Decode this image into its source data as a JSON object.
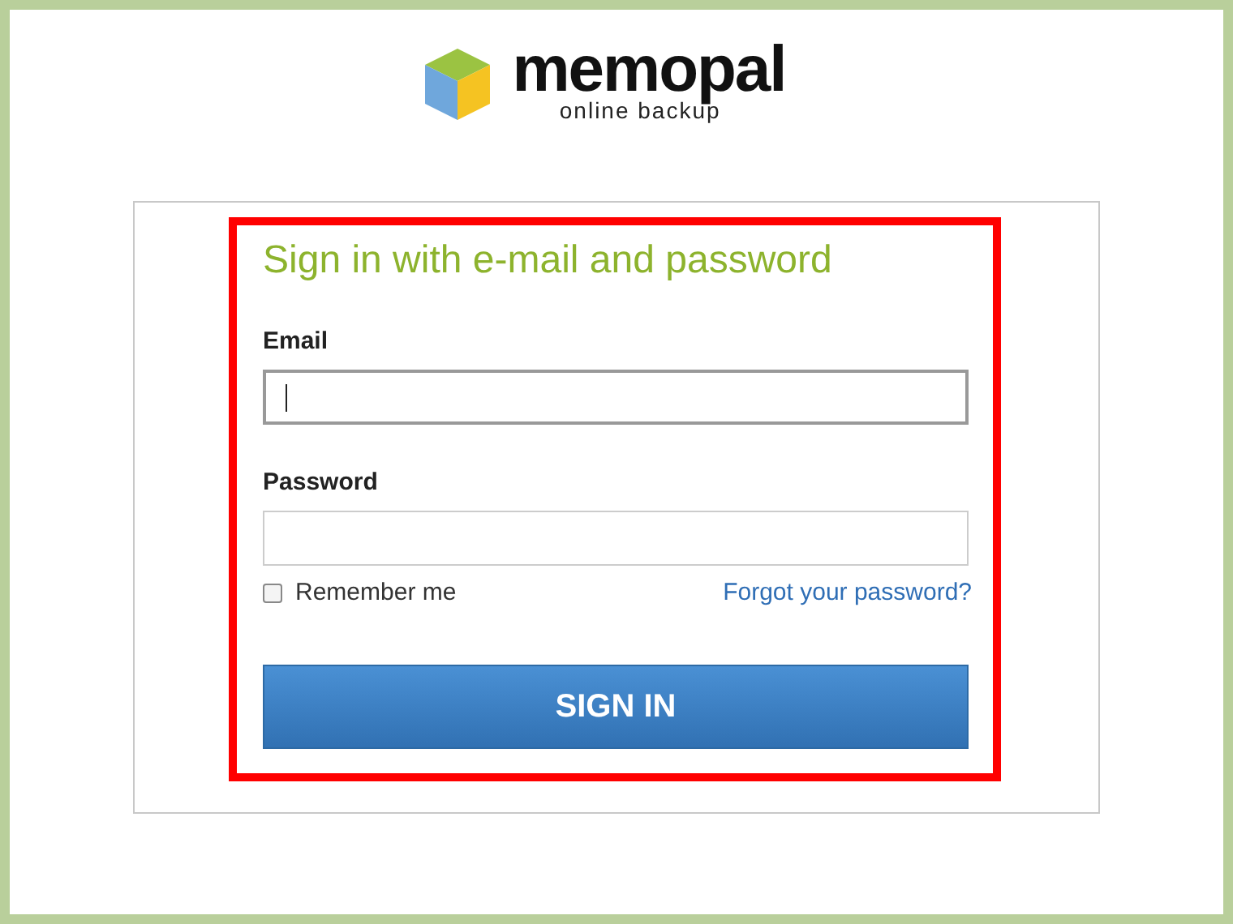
{
  "logo": {
    "name": "memopal",
    "tagline": "online backup"
  },
  "form": {
    "title": "Sign in with e-mail and password",
    "fields": [
      {
        "label": "Email",
        "focused": true
      },
      {
        "label": "Password",
        "focused": false
      }
    ],
    "remember": {
      "label": "Remember me",
      "checked": false
    },
    "forgot_link": "Forgot your password?",
    "submit": "SIGN IN"
  }
}
